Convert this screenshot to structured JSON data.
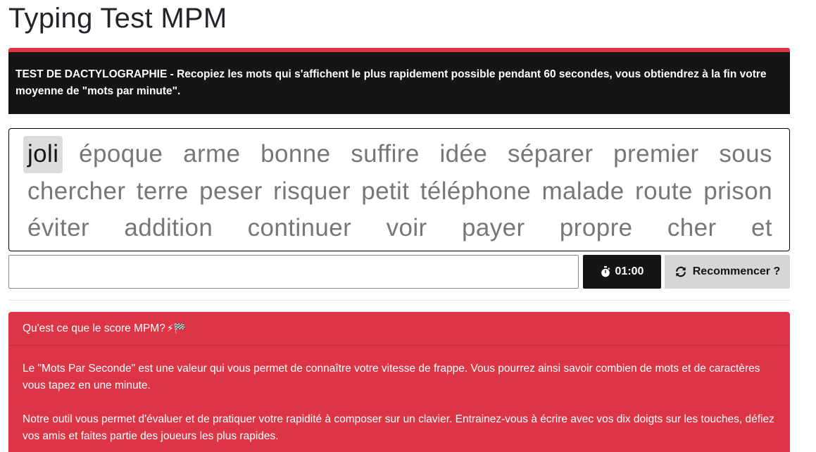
{
  "page": {
    "title": "Typing Test MPM"
  },
  "banner": {
    "text": "TEST DE DACTYLOGRAPHIE - Recopiez les mots qui s'affichent le plus rapidement possible pendant 60 secondes, vous obtiendrez à la fin votre moyenne de \"mots par minute\"."
  },
  "words": {
    "current_index": 0,
    "items": [
      "joli",
      "époque",
      "arme",
      "bonne",
      "suffire",
      "idée",
      "séparer",
      "premier",
      "sous",
      "chercher",
      "terre",
      "peser",
      "risquer",
      "petit",
      "téléphone",
      "malade",
      "route",
      "prison",
      "éviter",
      "addition",
      "continuer",
      "voir",
      "payer",
      "propre",
      "cher",
      "et"
    ]
  },
  "controls": {
    "input_value": "",
    "timer_label": "01:00",
    "timer_icon": "stopwatch-icon",
    "restart_label": "Recommencer ?",
    "restart_icon": "refresh-icon"
  },
  "info_card": {
    "header": "Qu'est ce que le score MPM?",
    "header_emojis": "⚡🏁",
    "paragraphs": [
      "Le \"Mots Par Seconde\" est une valeur qui vous permet de connaître votre vitesse de frappe. Vous pourrez ainsi savoir combien de mots et de caractères vous tapez en une minute.",
      "Notre outil vous permet d'évaluer et de pratiquer votre rapidité à composer sur un clavier. Entrainez-vous à écrire avec vos dix doigts sur les touches, défiez vos amis et faites partie des joueurs les plus rapides."
    ]
  },
  "colors": {
    "accent_red": "#dc3545",
    "dark": "#151515",
    "current_word_bg": "#dcdcdc",
    "restart_bg": "#d6d6d6"
  }
}
